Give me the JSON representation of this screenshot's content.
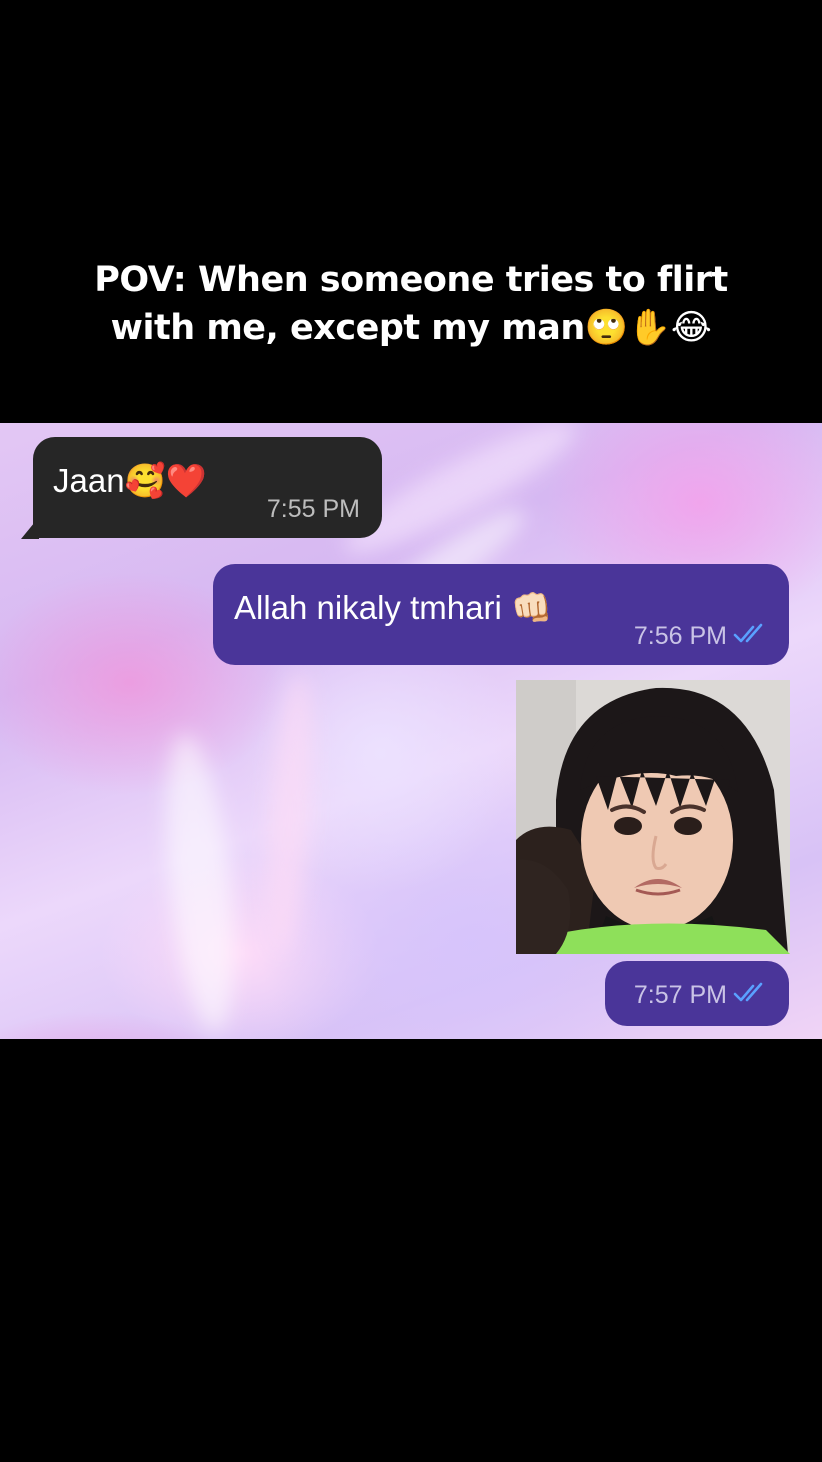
{
  "caption": {
    "line1": "POV: When someone tries to flirt",
    "line2": "with me, except my man🙄✋😂"
  },
  "messages": [
    {
      "direction": "incoming",
      "text": "Jaan🥰❤️",
      "time": "7:55 PM"
    },
    {
      "direction": "outgoing",
      "text": "Allah nikaly tmhari 👊🏻",
      "time": "7:56 PM",
      "status": "read"
    },
    {
      "direction": "outgoing",
      "type": "photo",
      "photo_subject": "pouting-child-photo",
      "time": "7:57 PM",
      "status": "read"
    }
  ],
  "colors": {
    "incoming_bubble": "#262626",
    "outgoing_bubble": "#4a3599",
    "read_ticks": "#5aa0ff",
    "page_background": "#000000"
  }
}
